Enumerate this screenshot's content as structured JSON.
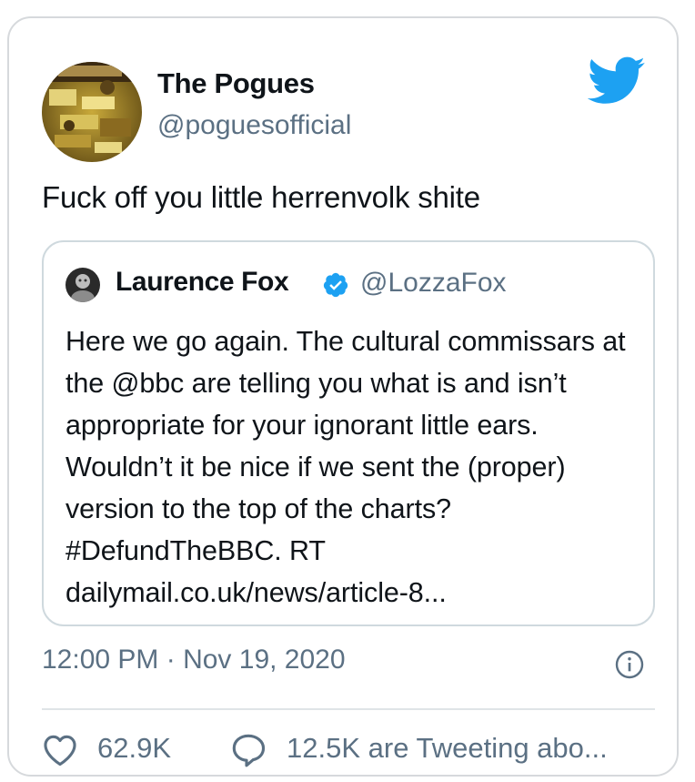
{
  "tweet": {
    "author_name": "The Pogues",
    "author_handle": "@poguesofficial",
    "avatar_icon": "pogues-album-art-avatar",
    "text": "Fuck off you little herrenvolk shite",
    "timestamp": "12:00 PM · Nov 19, 2020",
    "likes": "62.9K",
    "tweeting": "12.5K are Tweeting abo..."
  },
  "quoted_tweet": {
    "author_name": "Laurence Fox",
    "author_handle": "@LozzaFox",
    "verified": true,
    "avatar_icon": "laurence-fox-avatar",
    "text": "Here we go again. The cultural commissars at the @bbc are telling you what is and isn’t appropriate for your ignorant little ears. Wouldn’t it be nice if we sent the (proper) version to the top of the charts? #DefundTheBBC. RT dailymail.co.uk/news/article-8..."
  },
  "colors": {
    "twitter_blue": "#1da1f2",
    "secondary_text": "#5b7083",
    "border": "#d6d9dc"
  },
  "icons": [
    "twitter-bird-icon",
    "verified-badge-icon",
    "info-icon",
    "heart-icon",
    "reply-bubble-icon"
  ]
}
